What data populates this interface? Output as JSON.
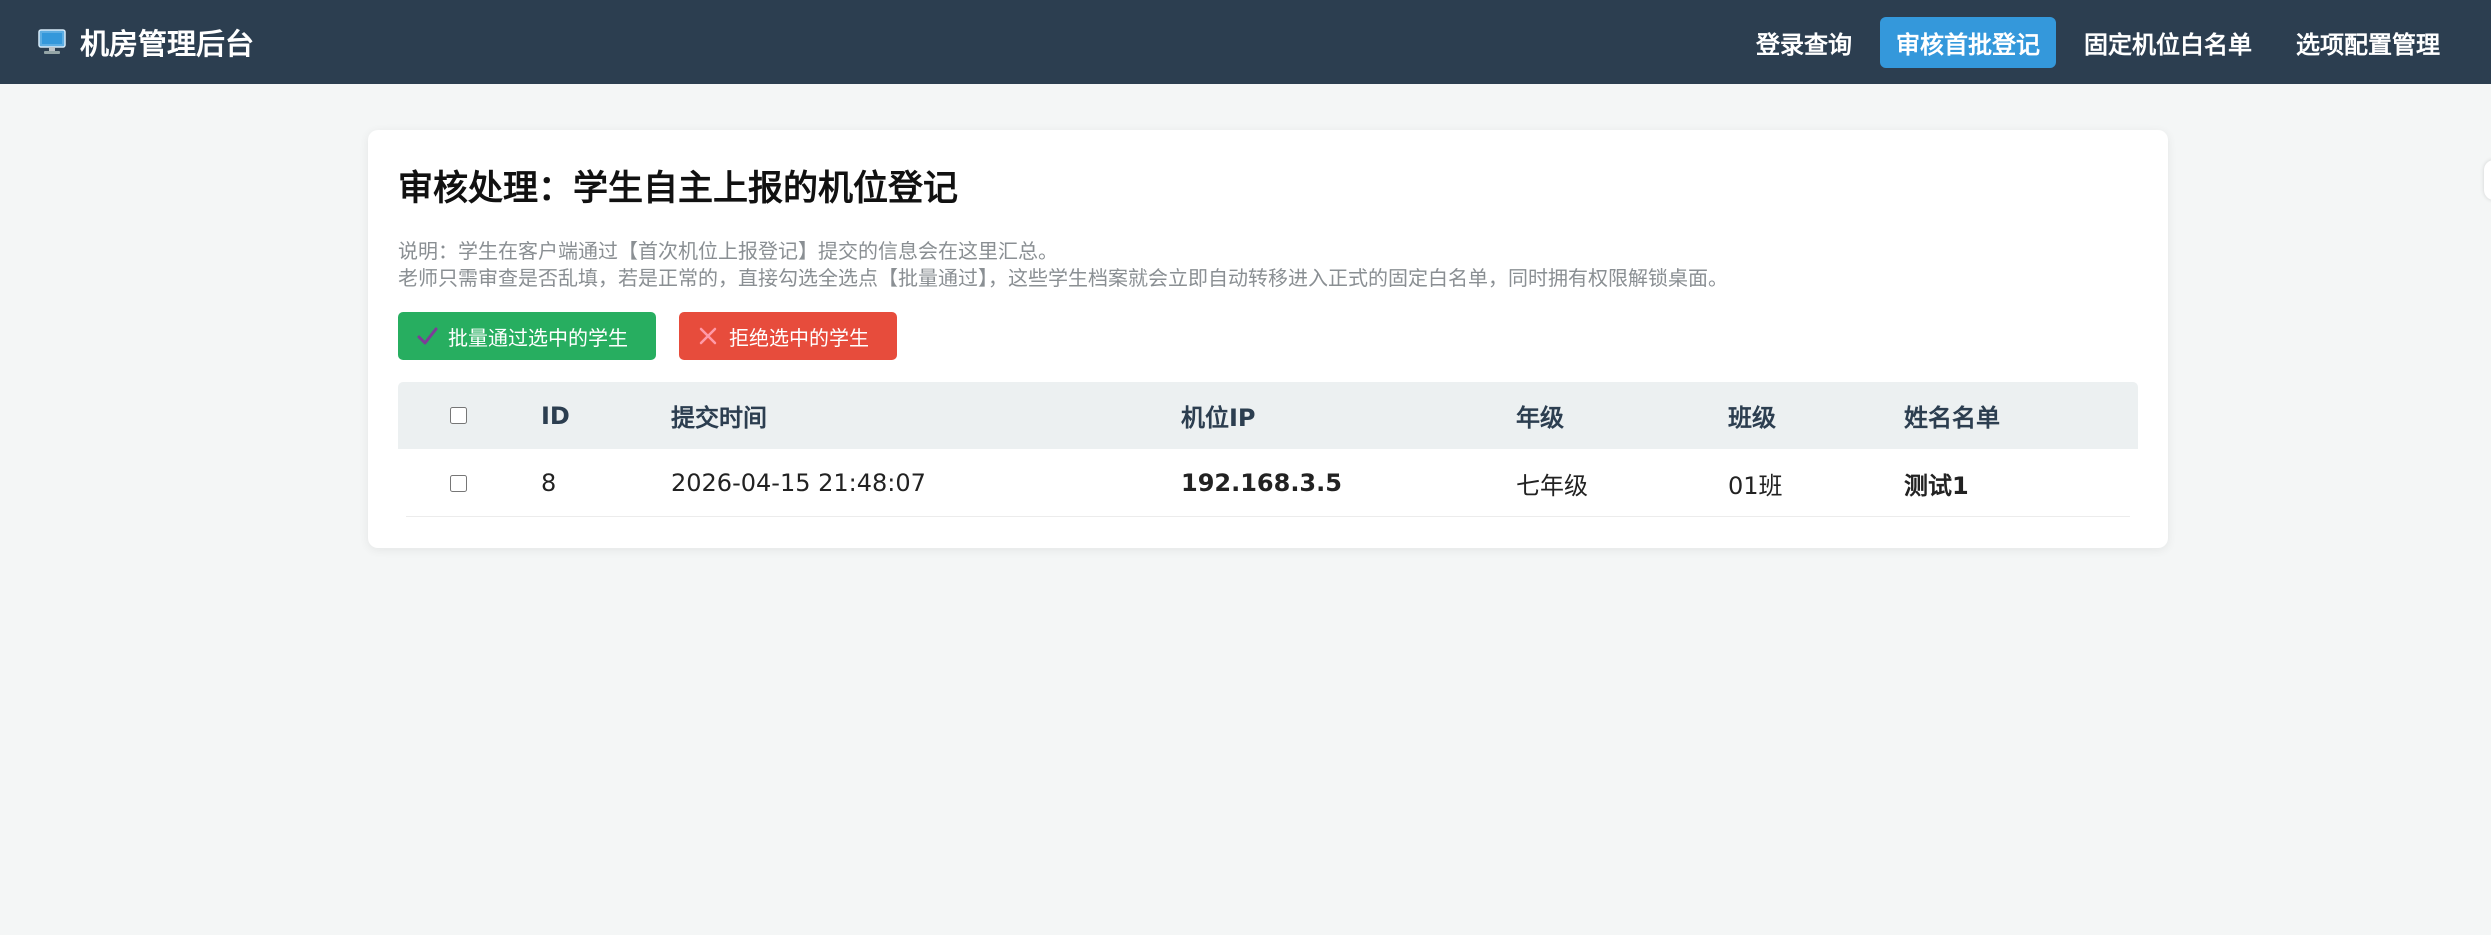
{
  "nav": {
    "brand_title": "机房管理后台",
    "brand_icon": "monitor-icon",
    "links": [
      {
        "label": "登录查询",
        "active": false
      },
      {
        "label": "审核首批登记",
        "active": true
      },
      {
        "label": "固定机位白名单",
        "active": false
      },
      {
        "label": "选项配置管理",
        "active": false
      }
    ]
  },
  "main": {
    "title": "审核处理：学生自主上报的机位登记",
    "description_line1": "说明：学生在客户端通过【首次机位上报登记】提交的信息会在这里汇总。",
    "description_line2": "老师只需审查是否乱填，若是正常的，直接勾选全选点【批量通过】，这些学生档案就会立即自动转移进入正式的固定白名单，同时拥有权限解锁桌面。",
    "approve_button": "批量通过选中的学生",
    "reject_button": "拒绝选中的学生",
    "approve_icon": "check-icon",
    "reject_icon": "cross-icon"
  },
  "table": {
    "headers": {
      "id": "ID",
      "time": "提交时间",
      "ip": "机位IP",
      "grade": "年级",
      "class": "班级",
      "name": "姓名名单"
    },
    "rows": [
      {
        "id": "8",
        "time": "2026-04-15 21:48:07",
        "ip": "192.168.3.5",
        "grade": "七年级",
        "class": "01班",
        "name": "测试1"
      }
    ]
  },
  "colors": {
    "navbar": "#2c3e50",
    "active_tab": "#3498db",
    "approve": "#27ae60",
    "reject": "#e74c3c",
    "ip_text": "#2980b9"
  }
}
